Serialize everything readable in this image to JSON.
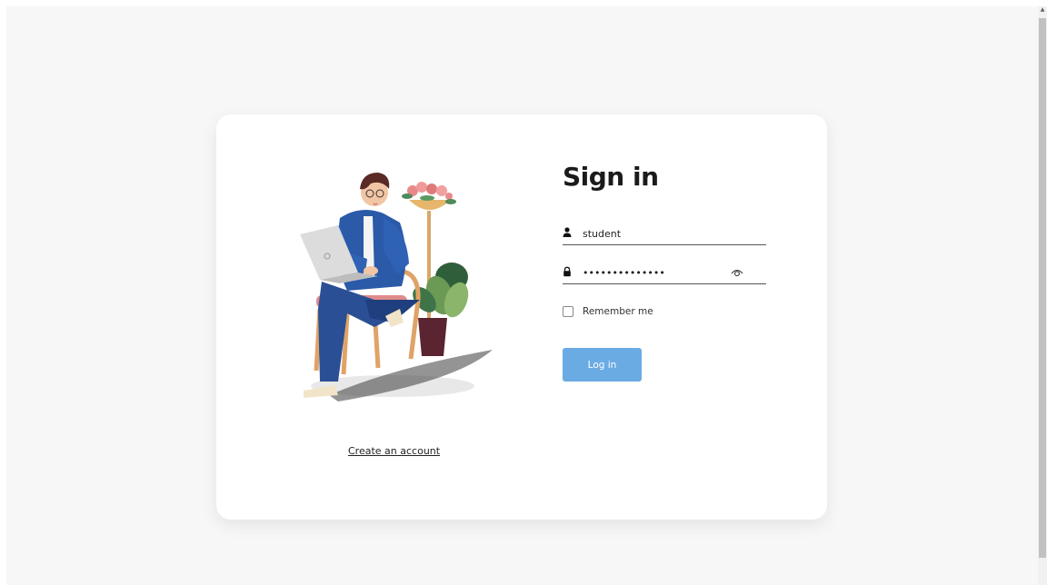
{
  "signin": {
    "title": "Sign in",
    "username_value": "student",
    "password_value": "••••••••••••••",
    "remember_label": "Remember me",
    "login_label": "Log in",
    "create_account_label": "Create an account"
  },
  "icons": {
    "username": "user-icon",
    "password": "lock-icon",
    "reveal": "eye-icon"
  },
  "colors": {
    "page_background": "#f7f7f7",
    "card_background": "#ffffff",
    "login_button": "#6aabe4",
    "title": "#1b1b1b"
  }
}
